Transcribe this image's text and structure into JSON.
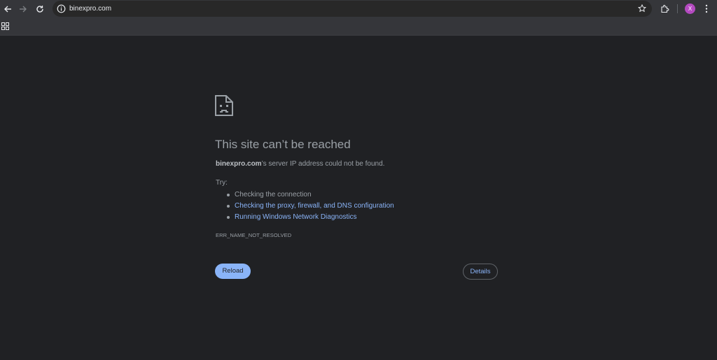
{
  "toolbar": {
    "url": "binexpro.com",
    "avatar_letter": "X"
  },
  "error_page": {
    "title": "This site can’t be reached",
    "summary_host": "binexpro.com",
    "summary_rest": "’s server IP address could not be found.",
    "try_label": "Try:",
    "suggestions": [
      {
        "text": "Checking the connection",
        "link": false
      },
      {
        "text": "Checking the proxy, firewall, and DNS configuration",
        "link": true
      },
      {
        "text": "Running Windows Network Diagnostics",
        "link": true
      }
    ],
    "error_code": "ERR_NAME_NOT_RESOLVED",
    "reload_label": "Reload",
    "details_label": "Details"
  },
  "colors": {
    "page_background": "#202124",
    "toolbar_background": "#35363a",
    "link": "#8ab4f8",
    "avatar": "#b44ac0"
  }
}
